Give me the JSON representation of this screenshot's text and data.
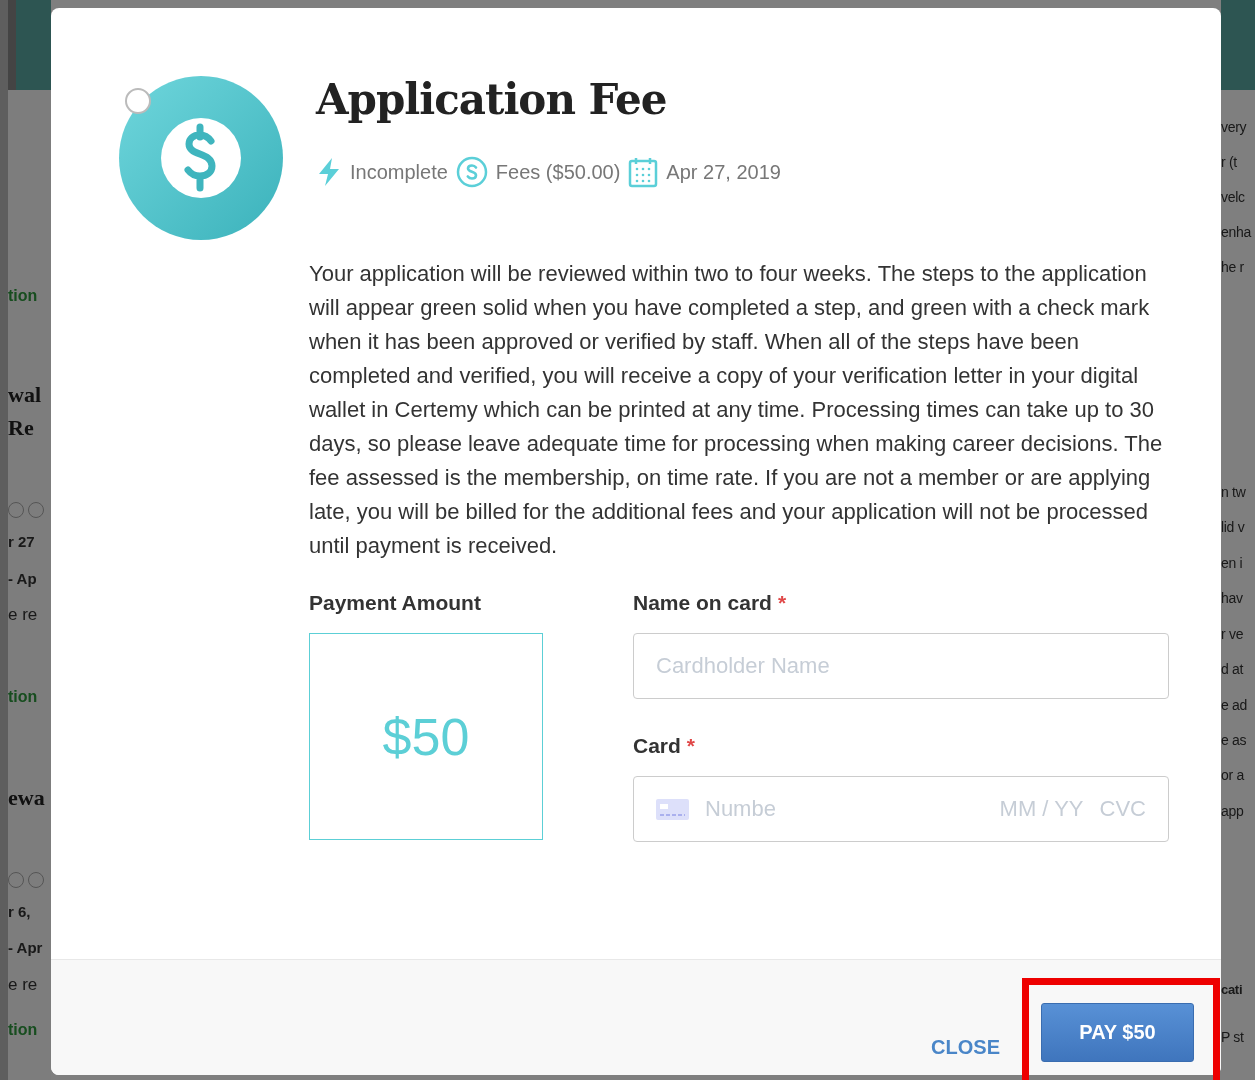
{
  "background": {
    "left_fragments": [
      {
        "kind": "link",
        "text": "tion"
      },
      {
        "kind": "heading",
        "text": "wal"
      },
      {
        "kind": "heading",
        "text": " Re"
      },
      {
        "kind": "dots"
      },
      {
        "kind": "strong",
        "text": "r 27"
      },
      {
        "kind": "strong",
        "text": "- Ap"
      },
      {
        "kind": "text",
        "text": "e re"
      },
      {
        "kind": "link",
        "text": "tion"
      },
      {
        "kind": "heading",
        "text": "ewa"
      },
      {
        "kind": "dots"
      },
      {
        "kind": "strong",
        "text": "r 6,"
      },
      {
        "kind": "strong",
        "text": "- Apr"
      },
      {
        "kind": "text",
        "text": "e re"
      },
      {
        "kind": "link",
        "text": "tion"
      }
    ],
    "right_fragments": [
      {
        "kind": "text",
        "text": "very"
      },
      {
        "kind": "text",
        "text": "r (t"
      },
      {
        "kind": "text",
        "text": "velc"
      },
      {
        "kind": "text",
        "text": "enha"
      },
      {
        "kind": "text",
        "text": "he r"
      },
      {
        "kind": "text",
        "text": "n tw"
      },
      {
        "kind": "text",
        "text": "lid v"
      },
      {
        "kind": "text",
        "text": "en i"
      },
      {
        "kind": "text",
        "text": "hav"
      },
      {
        "kind": "text",
        "text": "r ve"
      },
      {
        "kind": "text",
        "text": "d at"
      },
      {
        "kind": "text",
        "text": "e ad"
      },
      {
        "kind": "text",
        "text": "e as"
      },
      {
        "kind": "text",
        "text": "or a"
      },
      {
        "kind": "text",
        "text": "app"
      },
      {
        "kind": "strong",
        "text": "cati"
      },
      {
        "kind": "text",
        "text": "P st"
      }
    ]
  },
  "modal": {
    "title": "Application Fee",
    "meta": [
      {
        "kind": "status",
        "text": "Incomplete"
      },
      {
        "kind": "fee",
        "text": "Fees ($50.00)"
      },
      {
        "kind": "date",
        "text": "Apr 27, 2019"
      }
    ],
    "description": "Your application will be reviewed within two to four weeks. The steps to the application will appear green solid when you have completed a step, and green with a check mark when it has been approved or verified by staff. When all of the steps have been completed and verified, you will receive a copy of your verification letter in your digital wallet in Certemy which can be printed at any time. Processing times can take up to 30 days, so please leave adequate time for processing when making career decisions. The fee assessed is the membership, on time rate. If you are not a member or are applying late, you will be billed for the additional fees and your application will not be processed until payment is received.",
    "payment": {
      "label": "Payment Amount",
      "amount": "$50"
    },
    "fields": [
      {
        "kind": "text",
        "label": "Name on card",
        "required_mark": "*",
        "placeholder": "Cardholder Name"
      },
      {
        "kind": "card",
        "label": "Card",
        "required_mark": "*",
        "placeholder": "Numbe",
        "expiry_placeholder": "MM / YY",
        "cvc_placeholder": "CVC"
      }
    ],
    "buttons": [
      {
        "kind": "text",
        "label": "CLOSE",
        "highlighted": false
      },
      {
        "kind": "primary",
        "label": "PAY $50",
        "highlighted": true
      }
    ]
  }
}
